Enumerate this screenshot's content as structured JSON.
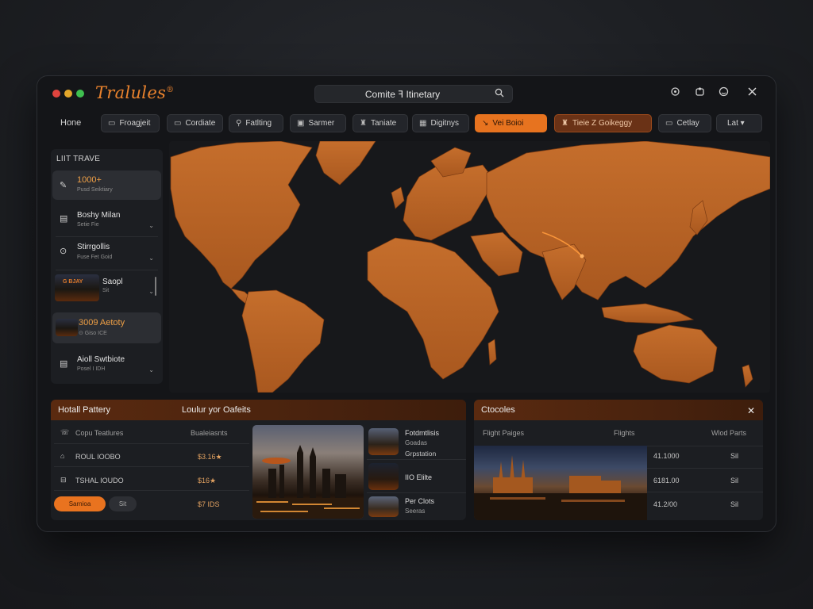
{
  "window": {
    "brand": "Tralules",
    "brand_mark": "®",
    "search_text": "Comite ꟻ Itinetary",
    "title_icons": [
      "settings-icon",
      "puzzle-icon",
      "face-icon",
      "close-icon"
    ]
  },
  "nav": {
    "items": [
      {
        "label": "Hone",
        "icon": ""
      },
      {
        "label": "Froagjeit",
        "icon": "▭"
      },
      {
        "label": "Cordiate",
        "icon": "▭"
      },
      {
        "label": "Fatlting",
        "icon": "⚲"
      },
      {
        "label": "Sarmer",
        "icon": "▣"
      },
      {
        "label": "Taniate",
        "icon": "♜"
      },
      {
        "label": "Digitnys",
        "icon": "▦"
      },
      {
        "label": "Vei Boioi",
        "icon": "↘"
      },
      {
        "label": "Tieie   Z  Goikeggy",
        "icon": "♜"
      },
      {
        "label": "Cetlay",
        "icon": "▭"
      },
      {
        "label": "Lat ▾",
        "icon": ""
      }
    ]
  },
  "sidebar": {
    "title": "LIIT TRAVE",
    "items": [
      {
        "title": "1000+",
        "sub": "Pusd Seiktiary",
        "icon": "✎"
      },
      {
        "title": "Boshy Milan",
        "sub": "Setie Fie",
        "icon": "▤"
      },
      {
        "title": "Stirrgollis",
        "sub": "Fuse Fet Goid",
        "icon": "⊙"
      },
      {
        "title": "Saopl",
        "sub": "Sit",
        "thumb_label": "G BJAY"
      },
      {
        "title": "3009 Aetoty",
        "sub": "⊙ Giso ICE"
      },
      {
        "title": "Aioll Swtbiote",
        "sub": "Posel I IDH",
        "icon": "▤"
      }
    ]
  },
  "hotels": {
    "head_left": "Hotall Pattery",
    "head_right": "Loulur yor Oafeits",
    "col_header_left": "Copu Teatlures",
    "col_header_right": "Bualeiasnts",
    "rows": [
      {
        "name": "ROUL IOOBO",
        "price": "$3.16★",
        "icon": "⌂"
      },
      {
        "name": "TSHAL IOUDO",
        "price": "$16★",
        "icon": "⊟"
      }
    ],
    "button_primary": "Sarnioa",
    "button_secondary": "Sit",
    "price_bottom": "$7 IDS",
    "side_items": [
      {
        "title": "Fotdmtlisis",
        "sub1": "Goadas",
        "sub2": "Grpstation"
      },
      {
        "title": "IIO Elilte"
      },
      {
        "title": "Per Clots",
        "sub": "Seeras"
      }
    ]
  },
  "flights": {
    "title": "Ctocoles",
    "col1": "Flight Paiges",
    "col2": "Flights",
    "col3": "Wlod Parts",
    "rows": [
      {
        "price": "41.1000",
        "val": "Sil"
      },
      {
        "price": "6181.00",
        "val": "Sil"
      },
      {
        "price": "41.2/00",
        "val": "Sil"
      }
    ]
  },
  "colors": {
    "accent": "#e9822d",
    "land": "#c06a2b",
    "panel": "#1c1e22",
    "background": "#141518"
  }
}
